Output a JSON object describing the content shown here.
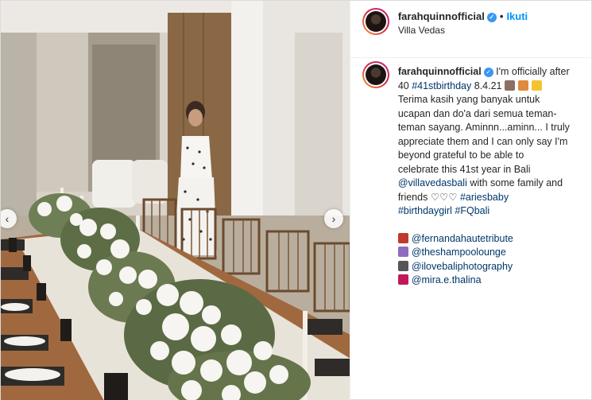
{
  "post": {
    "username": "farahquinnofficial",
    "follow_label": "Ikuti",
    "location": "Villa Vedas"
  },
  "media": {
    "prev_label": "‹",
    "next_label": "›"
  },
  "caption": {
    "username": "farahquinnofficial",
    "lines": [
      "I'm officially after",
      "40",
      "#41stbirthday",
      "8.4.21",
      "Terima kasih yang banyak untuk",
      "ucapan dan do'a dari semua teman-",
      "teman sayang. Aminnn...aminn... I truly",
      "appreciate them and I can only say I'm",
      "beyond grateful to be able to",
      "celebrate this 41st year in Bali",
      "@villavedasbali",
      "with some family and",
      "friends",
      "♡♡♡",
      "#ariesbaby",
      "#birthdaygirl",
      "#FQbali"
    ]
  },
  "credits": [
    {
      "icon": "dress-icon",
      "handle": "@fernandahautetribute",
      "color": "#c0392b"
    },
    {
      "icon": "woman-icon",
      "handle": "@theshampoolounge",
      "color": "#8e6bbf"
    },
    {
      "icon": "camera-icon",
      "handle": "@ilovebaliphotography",
      "color": "#555555"
    },
    {
      "icon": "lipstick-icon",
      "handle": "@mira.e.thalina",
      "color": "#c2185b"
    }
  ],
  "colors": {
    "link": "#00376b",
    "follow": "#0095f6",
    "verified": "#3897f0"
  }
}
